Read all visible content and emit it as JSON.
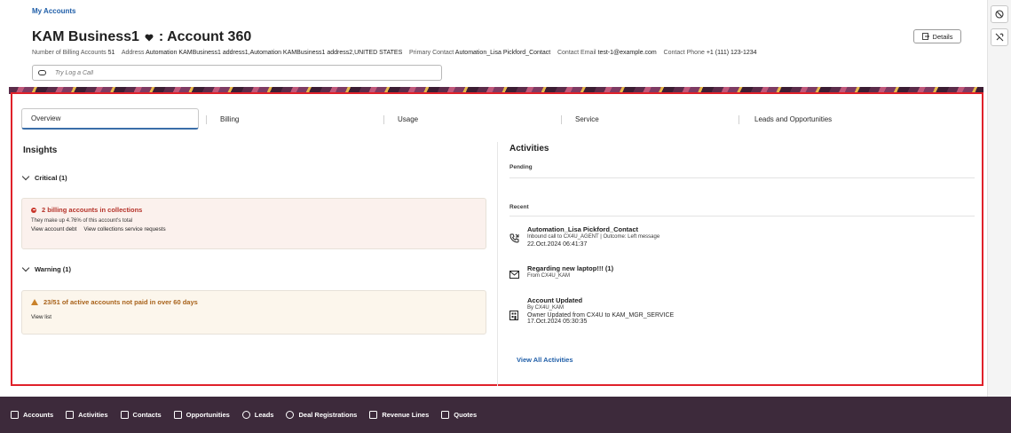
{
  "breadcrumb": "My Accounts",
  "account": {
    "title": "KAM Business1",
    "title_suffix": ": Account 360",
    "details_label": "Details"
  },
  "meta": {
    "billing_label": "Number of Billing Accounts",
    "billing_value": "51",
    "address_label": "Address",
    "address_value": "Automation KAMBusiness1 address1,Automation KAMBusiness1 address2,UNITED STATES",
    "primary_label": "Primary Contact",
    "primary_value": "Automation_Lisa Pickford_Contact",
    "email_label": "Contact Email",
    "email_value": "test-1@example.com",
    "phone_label": "Contact Phone",
    "phone_value": "+1 (111) 123-1234"
  },
  "log_call": {
    "placeholder": "Try Log a Call"
  },
  "tabs": [
    {
      "label": "Overview",
      "active": true
    },
    {
      "label": "Billing"
    },
    {
      "label": "Usage"
    },
    {
      "label": "Service"
    },
    {
      "label": "Leads and Opportunities"
    }
  ],
  "insights": {
    "title": "Insights",
    "critical": {
      "header": "Critical (1)",
      "alert_title": "2 billing accounts in collections",
      "alert_sub": "They make up 4.76% of this account's total",
      "link1": "View account debt",
      "link2": "View collections service requests"
    },
    "warning": {
      "header": "Warning (1)",
      "alert_title": "23/51 of active accounts not paid in over 60 days",
      "link1": "View list"
    }
  },
  "activities": {
    "title": "Activities",
    "pending_label": "Pending",
    "recent_label": "Recent",
    "items": [
      {
        "icon": "phone-icon",
        "title": "Automation_Lisa Pickford_Contact",
        "sub": "Inbound call to CX4U_AGENT | Outcome: Left message",
        "line1": "22.Oct.2024 06:41:37"
      },
      {
        "icon": "mail-icon",
        "title": "Regarding new laptop!!! (1)",
        "sub": "From CX4U_KAM"
      },
      {
        "icon": "building-icon",
        "title": "Account Updated",
        "sub": "By CX4U_KAM",
        "line1": "Owner Updated from CX4U to KAM_MGR_SERVICE",
        "line2": "17.Oct.2024 05:30:35"
      }
    ],
    "view_all": "View All Activities"
  },
  "bottom_nav": [
    {
      "label": "Accounts",
      "icon": "accounts-icon"
    },
    {
      "label": "Activities",
      "icon": "calendar-icon"
    },
    {
      "label": "Contacts",
      "icon": "contacts-icon"
    },
    {
      "label": "Opportunities",
      "icon": "opportunities-icon"
    },
    {
      "label": "Leads",
      "icon": "leads-icon"
    },
    {
      "label": "Deal Registrations",
      "icon": "deal-icon"
    },
    {
      "label": "Revenue Lines",
      "icon": "revenue-icon"
    },
    {
      "label": "Quotes",
      "icon": "quotes-icon"
    }
  ],
  "colors": {
    "accent": "#1f5ea8",
    "critical": "#c9372c",
    "warning": "#c9822a",
    "nav_bg": "#3d2a3b",
    "highlight_border": "#e0212a"
  }
}
